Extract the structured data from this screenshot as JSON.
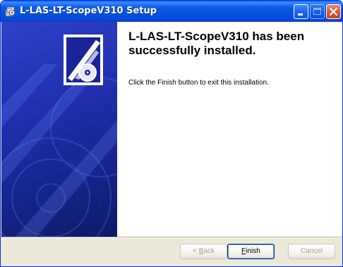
{
  "window": {
    "title": "L-LAS-LT-ScopeV310 Setup",
    "icons": {
      "app": "setup-disk-icon",
      "minimize": "minimize-icon",
      "maximize": "maximize-icon",
      "close": "close-icon"
    }
  },
  "banner": {
    "graphic": "installer-disc-banner"
  },
  "content": {
    "heading": "L-LAS-LT-ScopeV310 has been successfully installed.",
    "description": "Click the Finish button to exit this installation."
  },
  "buttons": {
    "back": {
      "mnemonic": "B",
      "rest": "ack",
      "prefix": "< ",
      "enabled": false
    },
    "finish": {
      "mnemonic": "F",
      "rest": "inish",
      "enabled": true
    },
    "cancel": {
      "label": "Cancel",
      "enabled": false
    }
  },
  "colors": {
    "titlebar": "#0553e0",
    "banner": "#1f2fae",
    "close": "#d75a32"
  }
}
